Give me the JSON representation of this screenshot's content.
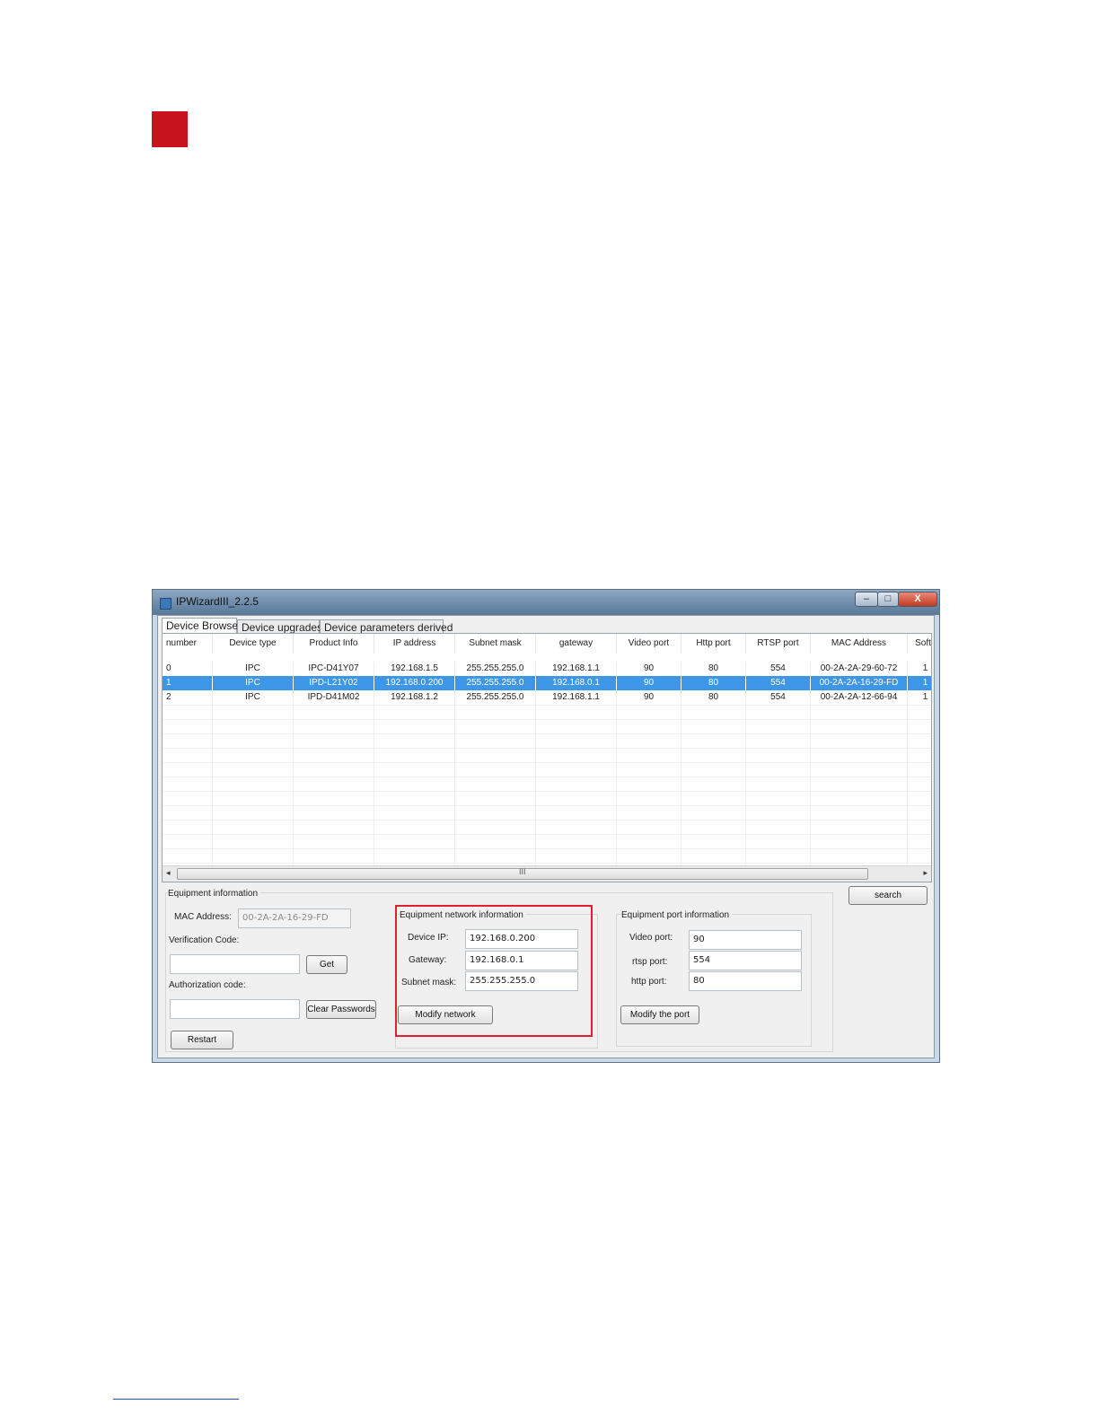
{
  "window": {
    "title": "IPWizardIII_2.2.5",
    "controls": {
      "minimize": "–",
      "maximize": "□",
      "close": "X"
    }
  },
  "tabs": [
    {
      "label": "Device Browse",
      "active": true
    },
    {
      "label": "Device upgrades",
      "active": false
    },
    {
      "label": "Device parameters derived",
      "active": false
    }
  ],
  "table": {
    "columns": [
      "number",
      "Device type",
      "Product Info",
      "IP address",
      "Subnet mask",
      "gateway",
      "Video port",
      "Http port",
      "RTSP port",
      "MAC Address",
      "Softv"
    ],
    "rows": [
      {
        "cells": [
          "0",
          "IPC",
          "IPC-D41Y07",
          "192.168.1.5",
          "255.255.255.0",
          "192.168.1.1",
          "90",
          "80",
          "554",
          "00-2A-2A-29-60-72",
          "1"
        ],
        "selected": false
      },
      {
        "cells": [
          "1",
          "IPC",
          "IPD-L21Y02",
          "192.168.0.200",
          "255.255.255.0",
          "192.168.0.1",
          "90",
          "80",
          "554",
          "00-2A-2A-16-29-FD",
          "1"
        ],
        "selected": true
      },
      {
        "cells": [
          "2",
          "IPC",
          "IPD-D41M02",
          "192.168.1.2",
          "255.255.255.0",
          "192.168.1.1",
          "90",
          "80",
          "554",
          "00-2A-2A-12-66-94",
          "1"
        ],
        "selected": false
      }
    ],
    "scroll_grip": "III",
    "scroll_left": "◂",
    "scroll_right": "▸"
  },
  "equipment": {
    "title": "Equipment information",
    "mac_label": "MAC Address:",
    "mac_value": "00-2A-2A-16-29-FD",
    "verification_label": "Verification Code:",
    "verification_value": "",
    "get_button": "Get",
    "authorization_label": "Authorization code:",
    "authorization_value": "",
    "clear_button": "Clear Passwords",
    "restart_button": "Restart"
  },
  "network": {
    "title": "Equipment network information",
    "ip_label": "Device IP:",
    "ip_value": "192.168.0.200",
    "gateway_label": "Gateway:",
    "gateway_value": "192.168.0.1",
    "subnet_label": "Subnet mask:",
    "subnet_value": "255.255.255.0",
    "modify_button": "Modify network"
  },
  "ports": {
    "title": "Equipment port information",
    "video_label": "Video port:",
    "video_value": "90",
    "rtsp_label": "rtsp port:",
    "rtsp_value": "554",
    "http_label": "http port:",
    "http_value": "80",
    "modify_button": "Modify the port"
  },
  "search_button": "search",
  "colors": {
    "accent_red": "#c8141c",
    "selection_blue": "#3d96e6",
    "highlight_red": "#e02030"
  }
}
